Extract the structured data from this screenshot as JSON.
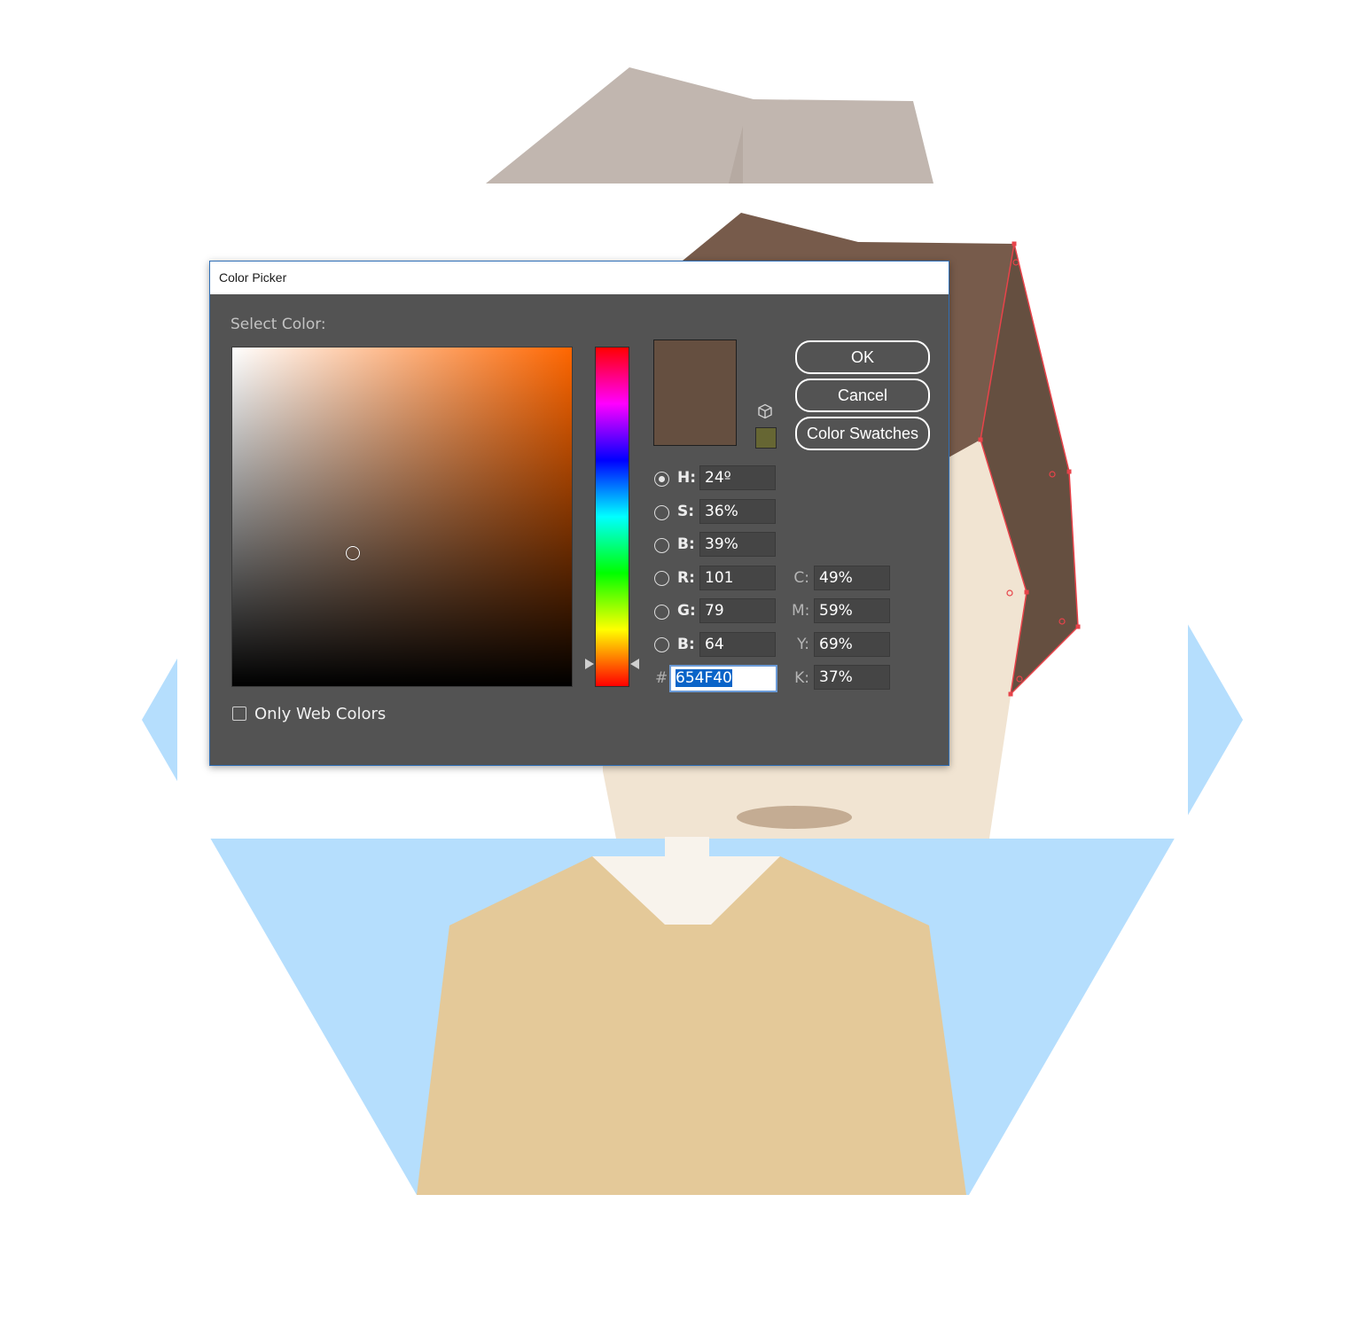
{
  "dialog": {
    "title": "Color Picker",
    "select_color_label": "Select Color:",
    "ok_label": "OK",
    "cancel_label": "Cancel",
    "swatches_label": "Color Swatches",
    "web_only_label": "Only Web Colors",
    "new_color": "#654F40",
    "web_safe_color": "#666633",
    "hsb": {
      "h_label": "H:",
      "h_value": "24º",
      "s_label": "S:",
      "s_value": "36%",
      "b_label": "B:",
      "b_value": "39%"
    },
    "rgb": {
      "r_label": "R:",
      "r_value": "101",
      "g_label": "G:",
      "g_value": "79",
      "b_label": "B:",
      "b_value": "64"
    },
    "cmyk": {
      "c_label": "C:",
      "c_value": "49%",
      "m_label": "M:",
      "m_value": "59%",
      "y_label": "Y:",
      "y_value": "69%",
      "k_label": "K:",
      "k_value": "37%"
    },
    "hex_label": "#",
    "hex_value": "654F40"
  },
  "artwork": {
    "colors": {
      "background_hexagon": "#B5DEFD",
      "hair_top": "#C1B6AF",
      "hair": "#775B4B",
      "hair_selected": "#654F40",
      "skin": "#F1E4D2",
      "neck": "#F8F3EC",
      "shirt": "#E4C999",
      "mouth": "#C4AC93",
      "selection": "#E8434A"
    }
  }
}
